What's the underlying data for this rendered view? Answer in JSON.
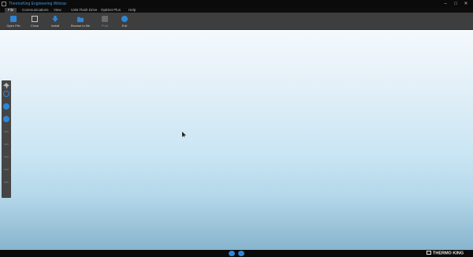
{
  "window": {
    "title": "ThermoKing Engineering Wintrac",
    "min_glyph": "–",
    "max_glyph": "□",
    "close_glyph": "✕"
  },
  "menu": {
    "items": [
      {
        "label": "File",
        "active": true
      },
      {
        "label": "Communications"
      },
      {
        "label": "View"
      },
      {
        "label": "USB Flash Drive"
      },
      {
        "label": "OptiSet Plus"
      },
      {
        "label": "Help"
      }
    ]
  },
  "toolbar": {
    "buttons": [
      {
        "label": "Open File",
        "icon": "folder-open-icon"
      },
      {
        "label": "Close",
        "icon": "close-doc-icon"
      },
      {
        "label": "Install",
        "icon": "install-icon"
      },
      {
        "label": "Browse to file",
        "icon": "browse-folder-icon"
      },
      {
        "label": "Print",
        "icon": "print-icon",
        "disabled": true
      },
      {
        "label": "Exit",
        "icon": "exit-icon"
      }
    ]
  },
  "sidebar": {
    "icons": [
      "pin-icon",
      "link-icon",
      "connect-icon",
      "device-icon"
    ]
  },
  "statusbar": {
    "brand": "THERMO KING"
  },
  "colors": {
    "accent": "#2f86d6",
    "workspace_top": "#f4f9fd",
    "workspace_bottom": "#87b4cd",
    "chrome": "#3e3e3e"
  }
}
